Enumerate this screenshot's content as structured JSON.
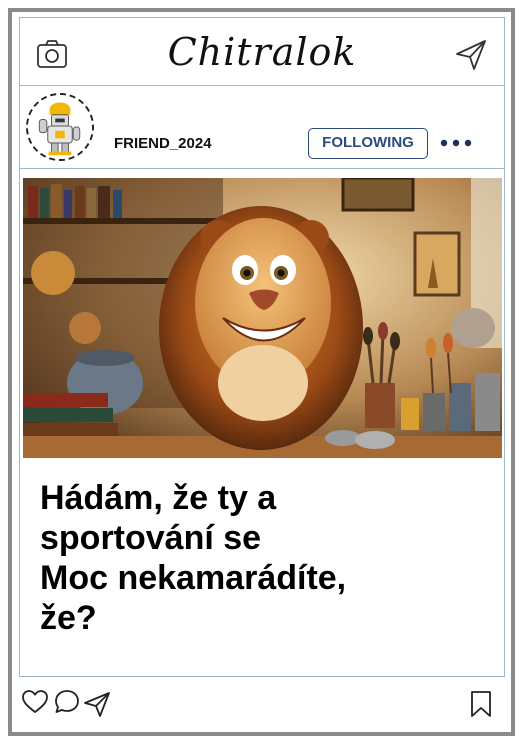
{
  "header": {
    "brand": "Chitralok",
    "camera_icon": "camera-icon",
    "send_icon": "send-icon"
  },
  "profile": {
    "username": "FRIEND_2024",
    "follow_label": "FOLLOWING",
    "more_icon": "more-icon"
  },
  "post": {
    "caption_lines": [
      "Hádám, že ty a",
      "sportování se",
      "Moc nekamarádíte,",
      "že?"
    ]
  },
  "actions": {
    "icons": [
      "heart-icon",
      "comment-icon",
      "share-icon",
      "bookmark-icon"
    ]
  },
  "colors": {
    "frame": "#8a8a8a",
    "divider": "#9fb8c8",
    "follow_accent": "#2c4a7a",
    "more_dots": "#1c2f55"
  }
}
